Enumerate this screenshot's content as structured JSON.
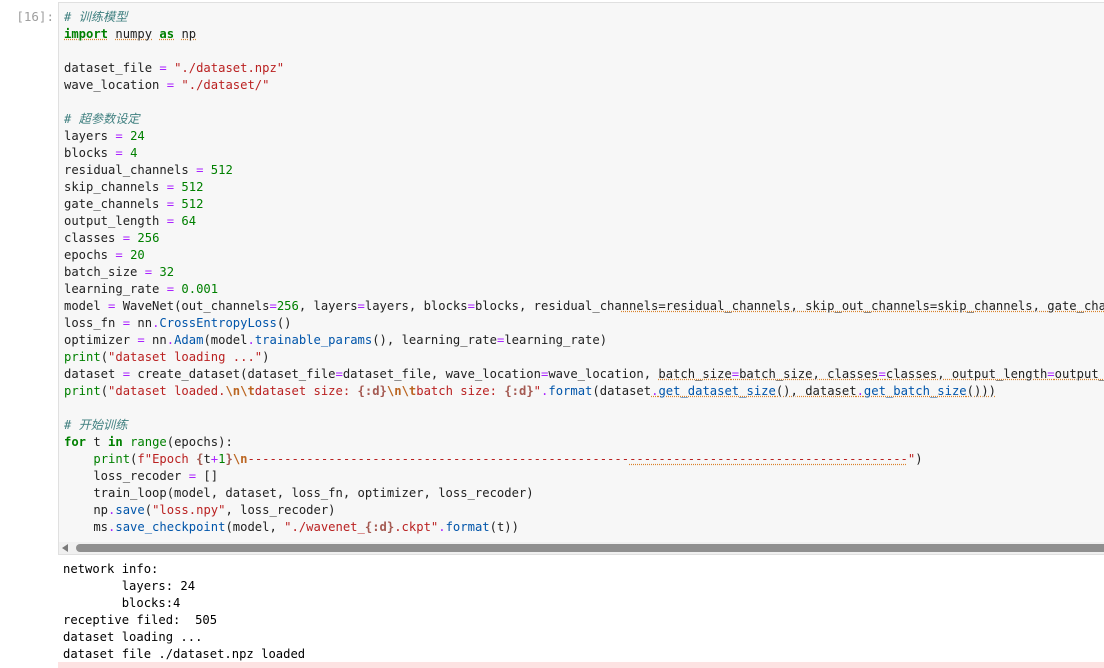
{
  "cell": {
    "prompt": "[16]:"
  },
  "code_lines": [
    "# 训练模型",
    "import numpy as np",
    "",
    "dataset_file = \"./dataset.npz\"",
    "wave_location = \"./dataset/\"",
    "",
    "# 超参数设定",
    "layers = 24",
    "blocks = 4",
    "residual_channels = 512",
    "skip_channels = 512",
    "gate_channels = 512",
    "output_length = 64",
    "classes = 256",
    "epochs = 20",
    "batch_size = 32",
    "learning_rate = 0.001",
    "model = WaveNet(out_channels=256, layers=layers, blocks=blocks, residual_channels=residual_channels, skip_out_channels=skip_channels, gate_channel",
    "loss_fn = nn.CrossEntropyLoss()",
    "optimizer = nn.Adam(model.trainable_params(), learning_rate=learning_rate)",
    "print(\"dataset loading ...\")",
    "dataset = create_dataset(dataset_file=dataset_file, wave_location=wave_location, batch_size=batch_size, classes=classes, output_length=output_leng",
    "print(\"dataset loaded.\\n\\tdataset size: {:d}\\n\\tbatch size: {:d}\".format(dataset.get_dataset_size(), dataset.get_batch_size()))",
    "",
    "# 开始训练",
    "for t in range(epochs):",
    "    print(f\"Epoch {t+1}\\n-------------------------------------------------------------------------------------------\")",
    "    loss_recoder = []",
    "    train_loop(model, dataset, loss_fn, optimizer, loss_recoder)",
    "    np.save(\"loss.npy\", loss_recoder)",
    "    ms.save_checkpoint(model, \"./wavenet_{:d}.ckpt\".format(t))"
  ],
  "output_lines": [
    "network info:",
    "        layers: 24",
    "        blocks:4",
    "receptive filed:  505",
    "dataset loading ...",
    "dataset file ./dataset.npz loaded"
  ]
}
